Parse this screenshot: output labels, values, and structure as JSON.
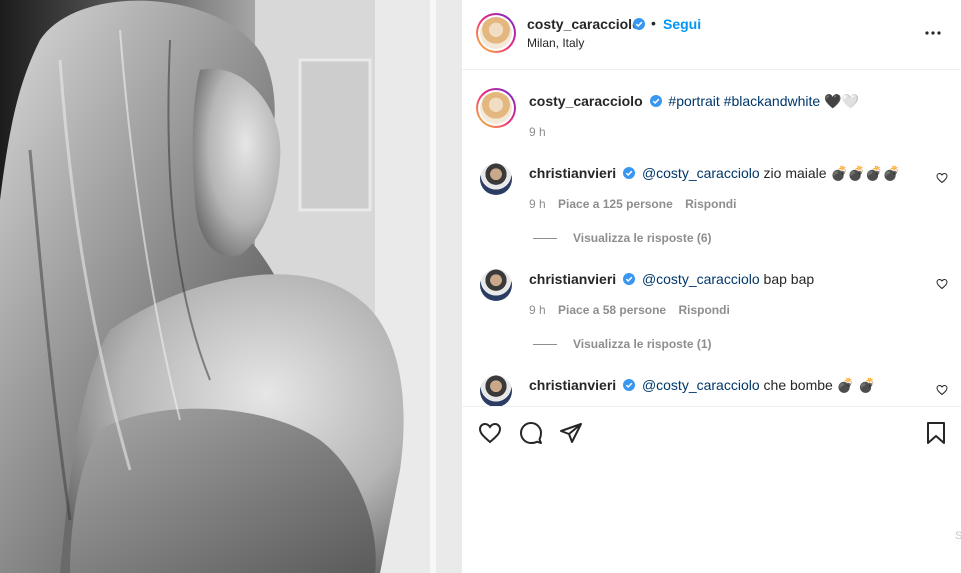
{
  "post": {
    "username": "costy_caracciolo",
    "follow_label": "Segui",
    "dot": "•",
    "location": "Milan, Italy"
  },
  "caption": {
    "username": "costy_caracciolo",
    "text": "#portrait #blackandwhite 🖤🤍",
    "time": "9 h"
  },
  "comments": [
    {
      "username": "christianvieri",
      "mention": "@costy_caracciolo",
      "text": " zio maiale 💣💣💣💣",
      "time": "9 h",
      "likes": "Piace a 125 persone",
      "reply": "Rispondi",
      "replies": "Visualizza le risposte (6)"
    },
    {
      "username": "christianvieri",
      "mention": "@costy_caracciolo",
      "text": " bap bap",
      "time": "9 h",
      "likes": "Piace a 58 persone",
      "reply": "Rispondi",
      "replies": "Visualizza le risposte (1)"
    },
    {
      "username": "christianvieri",
      "mention": "@costy_caracciolo",
      "text": " che bombe 💣 💣"
    }
  ],
  "icons": {
    "more": "more-options-icon",
    "verified": "verified-badge-icon",
    "like": "heart-icon",
    "comment": "comment-icon",
    "share": "share-icon",
    "save": "bookmark-icon"
  },
  "colors": {
    "accent": "#0095f6",
    "verified": "#3897f0",
    "muted": "#8e8e8e",
    "text": "#262626"
  },
  "scroll_hint": "S"
}
